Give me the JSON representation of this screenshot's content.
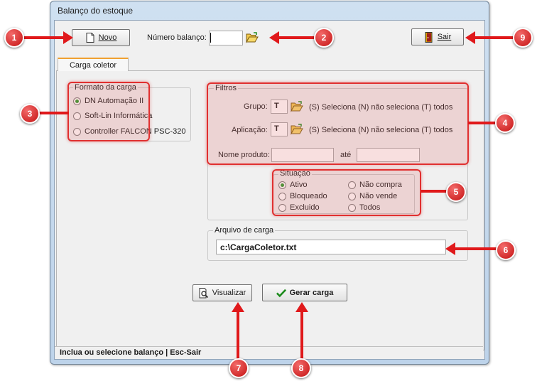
{
  "window": {
    "title": "Balanço do estoque"
  },
  "toolbar": {
    "novo_label": "Novo",
    "numero_balanco_label": "Número balanço:",
    "numero_balanco_value": "",
    "sair_label": "Sair"
  },
  "tabs": [
    {
      "label": "Carga coletor"
    }
  ],
  "formato": {
    "legend": "Formato da carga",
    "options": [
      {
        "label": "DN Automação II",
        "selected": true
      },
      {
        "label": "Soft-Lin Informática",
        "selected": false
      },
      {
        "label": "Controller FALCON PSC-320",
        "selected": false
      }
    ]
  },
  "filtros": {
    "legend": "Filtros",
    "grupo_label": "Grupo:",
    "grupo_value": "T",
    "grupo_hint": "(S) Seleciona (N) não seleciona (T) todos",
    "aplicacao_label": "Aplicação:",
    "aplicacao_value": "T",
    "aplicacao_hint": "(S) Seleciona (N) não seleciona (T) todos",
    "nome_produto_label": "Nome produto:",
    "nome_produto_from": "",
    "ate_label": "até",
    "nome_produto_to": ""
  },
  "situacao": {
    "legend": "Situação",
    "options": [
      {
        "label": "Ativo",
        "selected": true
      },
      {
        "label": "Não compra",
        "selected": false
      },
      {
        "label": "Bloqueado",
        "selected": false
      },
      {
        "label": "Não vende",
        "selected": false
      },
      {
        "label": "Excluido",
        "selected": false
      },
      {
        "label": "Todos",
        "selected": false
      }
    ]
  },
  "arquivo": {
    "legend": "Arquivo de carga",
    "value": "c:\\CargaColetor.txt"
  },
  "actions": {
    "visualizar_label": "Visualizar",
    "gerar_label": "Gerar carga"
  },
  "status": {
    "text": "Inclua ou selecione balanço  |  Esc-Sair"
  },
  "callouts": [
    "1",
    "2",
    "3",
    "4",
    "5",
    "6",
    "7",
    "8",
    "9"
  ],
  "colors": {
    "callout": "#d21a1a",
    "highlight_border": "#e03030",
    "accent_tab": "#f0a030",
    "check_green": "#1e8c1e"
  }
}
